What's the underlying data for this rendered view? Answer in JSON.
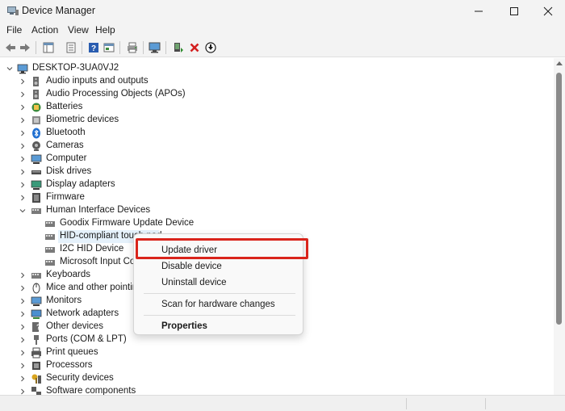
{
  "window": {
    "title": "Device Manager",
    "icons": {
      "app": "device-manager-icon",
      "minimize": "minimize-icon",
      "maximize": "maximize-icon",
      "close": "close-icon"
    }
  },
  "menu": [
    "File",
    "Action",
    "View",
    "Help"
  ],
  "toolbar": [
    "back-icon",
    "forward-icon",
    "show-hide-console-tree-icon",
    "properties-icon",
    "help-icon",
    "view-icon",
    "print-icon",
    "scan-hardware-icon",
    "add-driver-icon",
    "uninstall-icon",
    "download-update-icon"
  ],
  "tree": {
    "root": "DESKTOP-3UA0VJ2",
    "items": [
      {
        "label": "Audio inputs and outputs",
        "icon": "speaker-icon"
      },
      {
        "label": "Audio Processing Objects (APOs)",
        "icon": "speaker-icon"
      },
      {
        "label": "Batteries",
        "icon": "battery-icon"
      },
      {
        "label": "Biometric devices",
        "icon": "biometric-icon"
      },
      {
        "label": "Bluetooth",
        "icon": "bluetooth-icon"
      },
      {
        "label": "Cameras",
        "icon": "camera-icon"
      },
      {
        "label": "Computer",
        "icon": "computer-icon"
      },
      {
        "label": "Disk drives",
        "icon": "disk-drive-icon"
      },
      {
        "label": "Display adapters",
        "icon": "display-adapter-icon"
      },
      {
        "label": "Firmware",
        "icon": "firmware-icon"
      },
      {
        "label": "Human Interface Devices",
        "icon": "hid-icon"
      },
      {
        "label": "Goodix Firmware Update Device",
        "icon": "hid-device-icon"
      },
      {
        "label": "HID-compliant touch pad",
        "icon": "hid-device-icon"
      },
      {
        "label": "I2C HID Device",
        "icon": "hid-device-icon"
      },
      {
        "label": "Microsoft Input Cor",
        "icon": "hid-device-icon"
      },
      {
        "label": "Keyboards",
        "icon": "keyboard-icon"
      },
      {
        "label": "Mice and other pointin",
        "icon": "mouse-icon"
      },
      {
        "label": "Monitors",
        "icon": "monitor-icon"
      },
      {
        "label": "Network adapters",
        "icon": "network-adapter-icon"
      },
      {
        "label": "Other devices",
        "icon": "other-device-icon"
      },
      {
        "label": "Ports (COM & LPT)",
        "icon": "port-icon"
      },
      {
        "label": "Print queues",
        "icon": "printer-icon"
      },
      {
        "label": "Processors",
        "icon": "processor-icon"
      },
      {
        "label": "Security devices",
        "icon": "security-device-icon"
      },
      {
        "label": "Software components",
        "icon": "software-component-icon"
      }
    ]
  },
  "context_menu": {
    "update": "Update driver",
    "disable": "Disable device",
    "uninstall": "Uninstall device",
    "scan": "Scan for hardware changes",
    "properties": "Properties"
  },
  "colors": {
    "highlight_box": "#d9241b",
    "selection": "#e5f1fb"
  }
}
